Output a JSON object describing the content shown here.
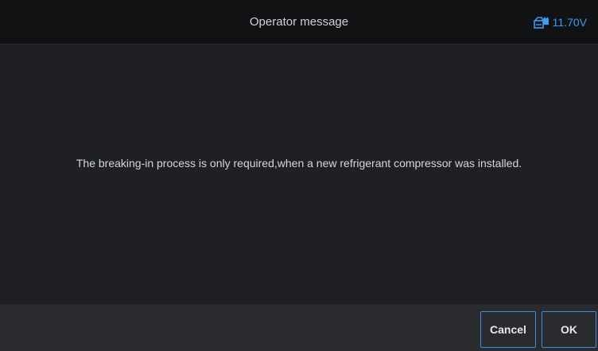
{
  "header": {
    "title": "Operator message",
    "voltage": "11.70V",
    "battery_icon": "car-battery-icon",
    "accent_color": "#3d9bf0"
  },
  "body": {
    "message": "The breaking-in process is only required,when a new refrigerant compressor was installed."
  },
  "footer": {
    "cancel_label": "Cancel",
    "ok_label": "OK"
  }
}
